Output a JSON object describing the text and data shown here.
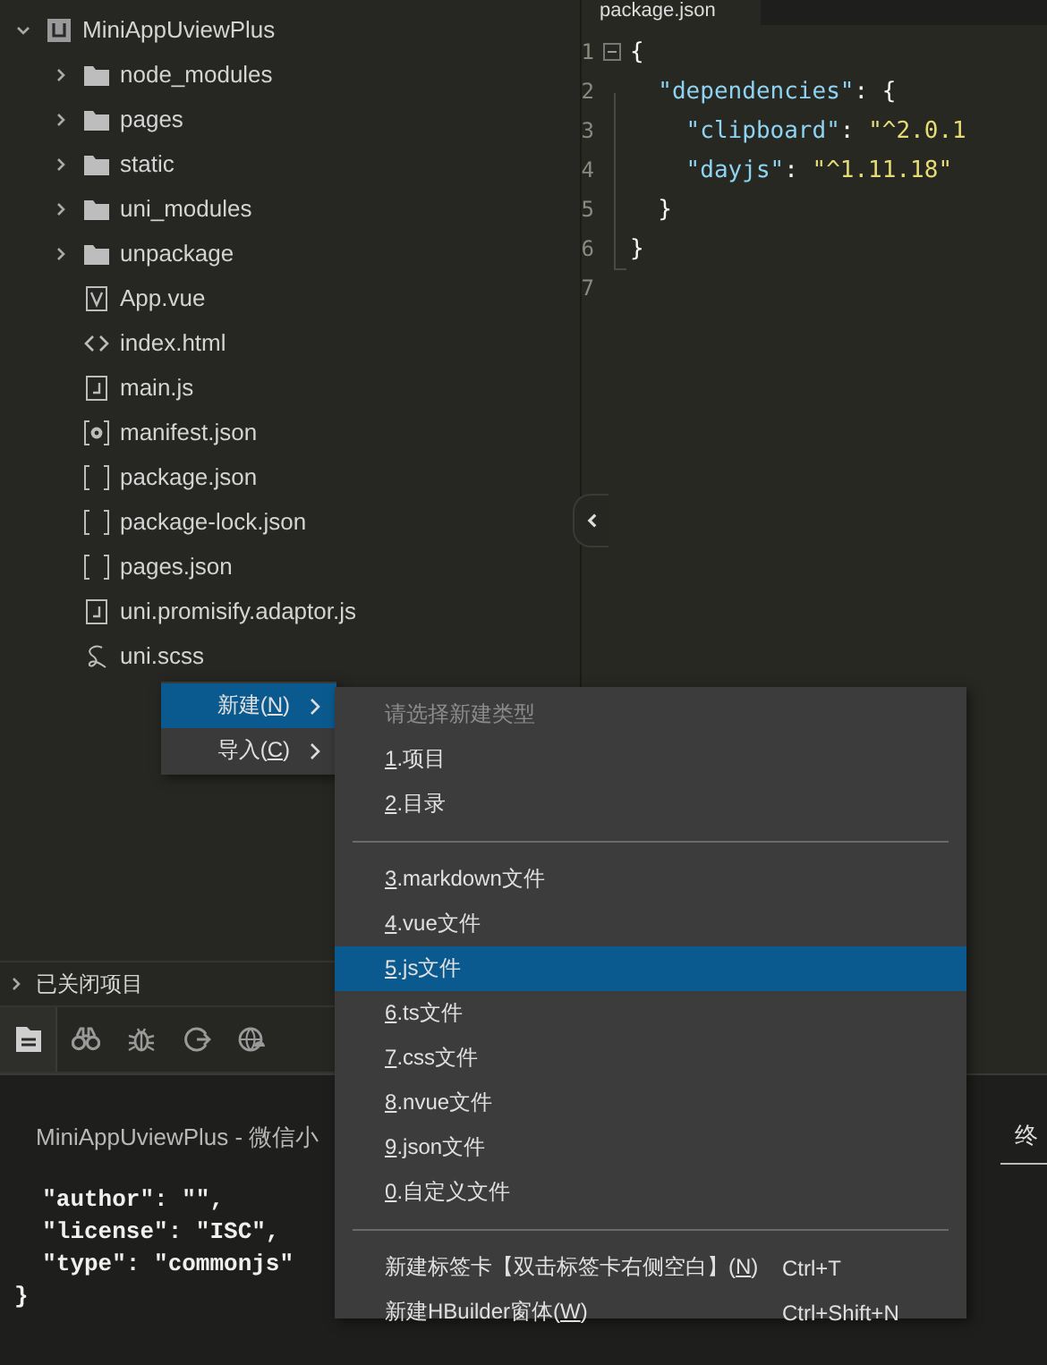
{
  "sidebar": {
    "tree": [
      {
        "label": "MiniAppUviewPlus",
        "kind": "project",
        "expanded": true,
        "children": [
          {
            "label": "node_modules",
            "kind": "folder",
            "expanded": false
          },
          {
            "label": "pages",
            "kind": "folder",
            "expanded": false
          },
          {
            "label": "static",
            "kind": "folder",
            "expanded": false
          },
          {
            "label": "uni_modules",
            "kind": "folder",
            "expanded": false
          },
          {
            "label": "unpackage",
            "kind": "folder",
            "expanded": false
          },
          {
            "label": "App.vue",
            "kind": "vue"
          },
          {
            "label": "index.html",
            "kind": "html"
          },
          {
            "label": "main.js",
            "kind": "js"
          },
          {
            "label": "manifest.json",
            "kind": "manifest"
          },
          {
            "label": "package.json",
            "kind": "json"
          },
          {
            "label": "package-lock.json",
            "kind": "json"
          },
          {
            "label": "pages.json",
            "kind": "json"
          },
          {
            "label": "uni.promisify.adaptor.js",
            "kind": "js"
          },
          {
            "label": "uni.scss",
            "kind": "scss"
          }
        ]
      }
    ],
    "closed_projects": {
      "label": "已关闭项目",
      "expanded": false
    },
    "tool_tabs": [
      {
        "kind": "files",
        "selected": true
      },
      {
        "kind": "search",
        "selected": false
      },
      {
        "kind": "debug",
        "selected": false
      },
      {
        "kind": "sync",
        "selected": false
      },
      {
        "kind": "web",
        "selected": false
      }
    ]
  },
  "editor": {
    "tab": {
      "label": "package.json"
    },
    "lines": [
      {
        "number": "1",
        "fold": true,
        "tokens": [
          {
            "kind": "punct",
            "text": "{"
          }
        ]
      },
      {
        "number": "2",
        "tokens": [
          {
            "kind": "key",
            "text": "  \"dependencies\""
          },
          {
            "kind": "punct",
            "text": ": {"
          }
        ]
      },
      {
        "number": "3",
        "tokens": [
          {
            "kind": "key",
            "text": "    \"clipboard\""
          },
          {
            "kind": "punct",
            "text": ": "
          },
          {
            "kind": "string",
            "text": "\"^2.0.1"
          }
        ]
      },
      {
        "number": "4",
        "tokens": [
          {
            "kind": "key",
            "text": "    \"dayjs\""
          },
          {
            "kind": "punct",
            "text": ": "
          },
          {
            "kind": "string",
            "text": "\"^1.11.18\""
          }
        ]
      },
      {
        "number": "5",
        "tokens": [
          {
            "kind": "punct",
            "text": "  }"
          }
        ]
      },
      {
        "number": "6",
        "tokens": [
          {
            "kind": "punct",
            "text": "}"
          }
        ]
      },
      {
        "number": "7"
      }
    ]
  },
  "context_menu": {
    "items": [
      {
        "pre": "新建(",
        "key": "N",
        "post": ")",
        "selected": true,
        "submenu": true
      },
      {
        "pre": "导入(",
        "key": "C",
        "post": ")",
        "selected": false,
        "submenu": true
      }
    ]
  },
  "submenu": {
    "header": "请选择新建类型",
    "items": [
      {
        "kind": "item",
        "key": "1",
        "post": ".项目",
        "selected": false
      },
      {
        "kind": "item",
        "key": "2",
        "post": ".目录",
        "selected": false
      },
      {
        "kind": "separator"
      },
      {
        "kind": "item",
        "key": "3",
        "post": ".markdown文件",
        "selected": false
      },
      {
        "kind": "item",
        "key": "4",
        "post": ".vue文件",
        "selected": false
      },
      {
        "kind": "item",
        "key": "5",
        "post": ".js文件",
        "selected": true
      },
      {
        "kind": "item",
        "key": "6",
        "post": ".ts文件",
        "selected": false
      },
      {
        "kind": "item",
        "key": "7",
        "post": ".css文件",
        "selected": false
      },
      {
        "kind": "item",
        "key": "8",
        "post": ".nvue文件",
        "selected": false
      },
      {
        "kind": "item",
        "key": "9",
        "post": ".json文件",
        "selected": false
      },
      {
        "kind": "item",
        "key": "0",
        "post": ".自定义文件",
        "selected": false
      },
      {
        "kind": "separator"
      },
      {
        "kind": "item",
        "pre": "新建标签卡【双击标签卡右侧空白】(",
        "key": "N",
        "post": ")",
        "shortcut": "Ctrl+T",
        "selected": false
      },
      {
        "kind": "item",
        "pre": "新建HBuilder窗体(",
        "key": "W",
        "post": ")",
        "shortcut": "Ctrl+Shift+N",
        "selected": false
      }
    ]
  },
  "console": {
    "title": "MiniAppUviewPlus - 微信小",
    "tab": {
      "label": "终",
      "selected": true
    },
    "lines": [
      "  \"author\": \"\",",
      "  \"license\": \"ISC\",",
      "  \"type\": \"commonjs\"",
      "}"
    ]
  }
}
